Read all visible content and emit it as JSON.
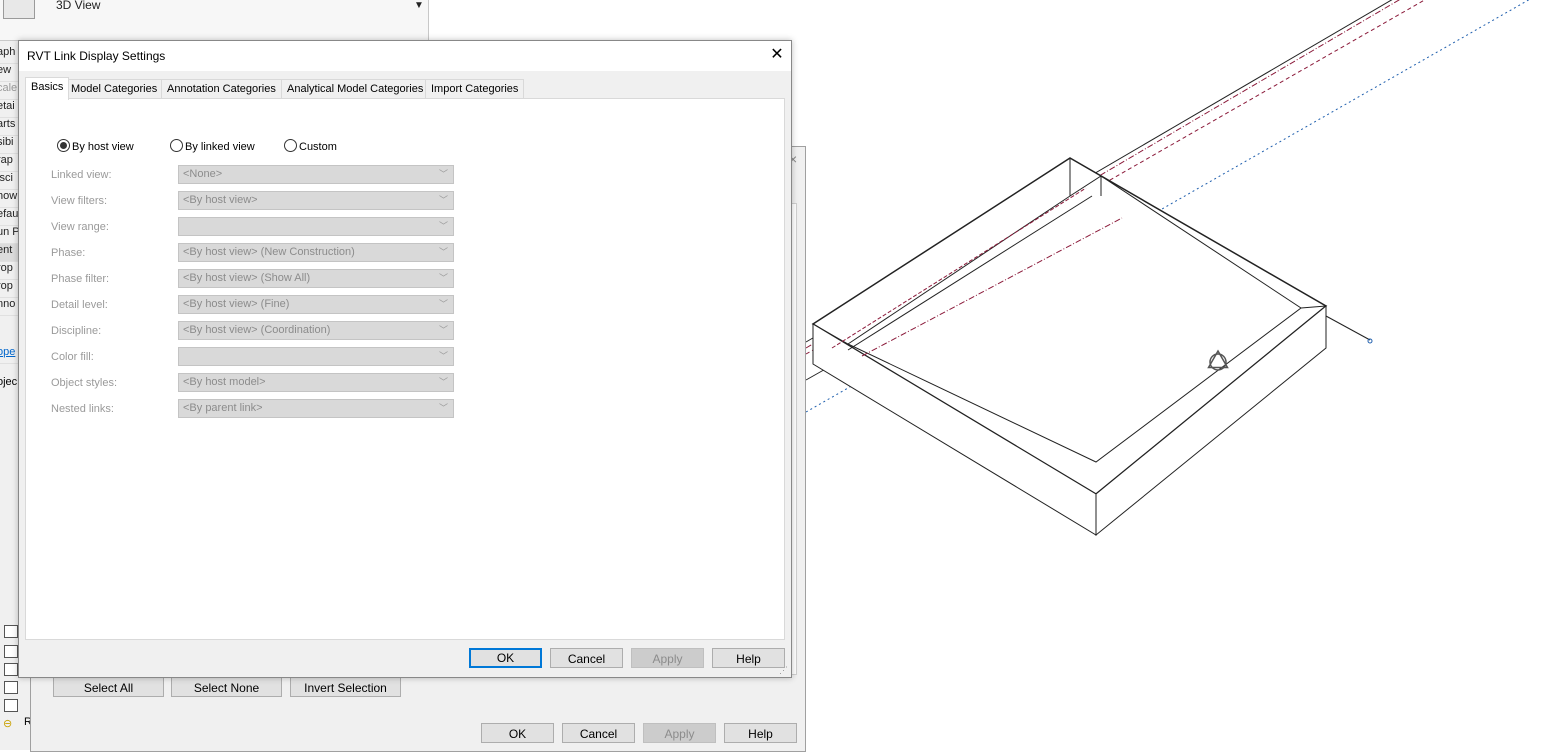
{
  "background": {
    "type_selector": {
      "label": "3D View"
    },
    "property_rows": [
      "aph",
      "ew",
      "cale",
      "etai",
      "arts",
      "sibi",
      "rap",
      "isci",
      "how",
      "efau",
      "un P",
      "ent",
      "rop",
      "rop",
      "nno",
      "ope"
    ],
    "project_label": "ojec",
    "link_item_letter": "R",
    "vg_dialog": {
      "select_all": "Select All",
      "select_none": "Select None",
      "invert_selection": "Invert Selection",
      "ok": "OK",
      "cancel": "Cancel",
      "apply": "Apply",
      "help": "Help"
    }
  },
  "dialog": {
    "title": "RVT Link Display Settings",
    "tabs": [
      "Basics",
      "Model Categories",
      "Annotation Categories",
      "Analytical Model Categories",
      "Import Categories"
    ],
    "active_tab": "Basics",
    "radios": [
      {
        "label": "By host view",
        "selected": true
      },
      {
        "label": "By linked view",
        "selected": false
      },
      {
        "label": "Custom",
        "selected": false
      }
    ],
    "fields": [
      {
        "label": "Linked view:",
        "value": "<None>"
      },
      {
        "label": "View filters:",
        "value": "<By host view>"
      },
      {
        "label": "View range:",
        "value": ""
      },
      {
        "label": "Phase:",
        "value": "<By host view> (New Construction)"
      },
      {
        "label": "Phase filter:",
        "value": "<By host view> (Show All)"
      },
      {
        "label": "Detail level:",
        "value": "<By host view> (Fine)"
      },
      {
        "label": "Discipline:",
        "value": "<By host view> (Coordination)"
      },
      {
        "label": "Color fill:",
        "value": ""
      },
      {
        "label": "Object styles:",
        "value": "<By host model>"
      },
      {
        "label": "Nested links:",
        "value": "<By parent link>"
      }
    ],
    "buttons": {
      "ok": "OK",
      "cancel": "Cancel",
      "apply": "Apply",
      "help": "Help"
    }
  },
  "colors": {
    "accent": "#0078d7",
    "dashed_red": "#8b1a3a",
    "dashed_blue": "#1f5fae"
  }
}
